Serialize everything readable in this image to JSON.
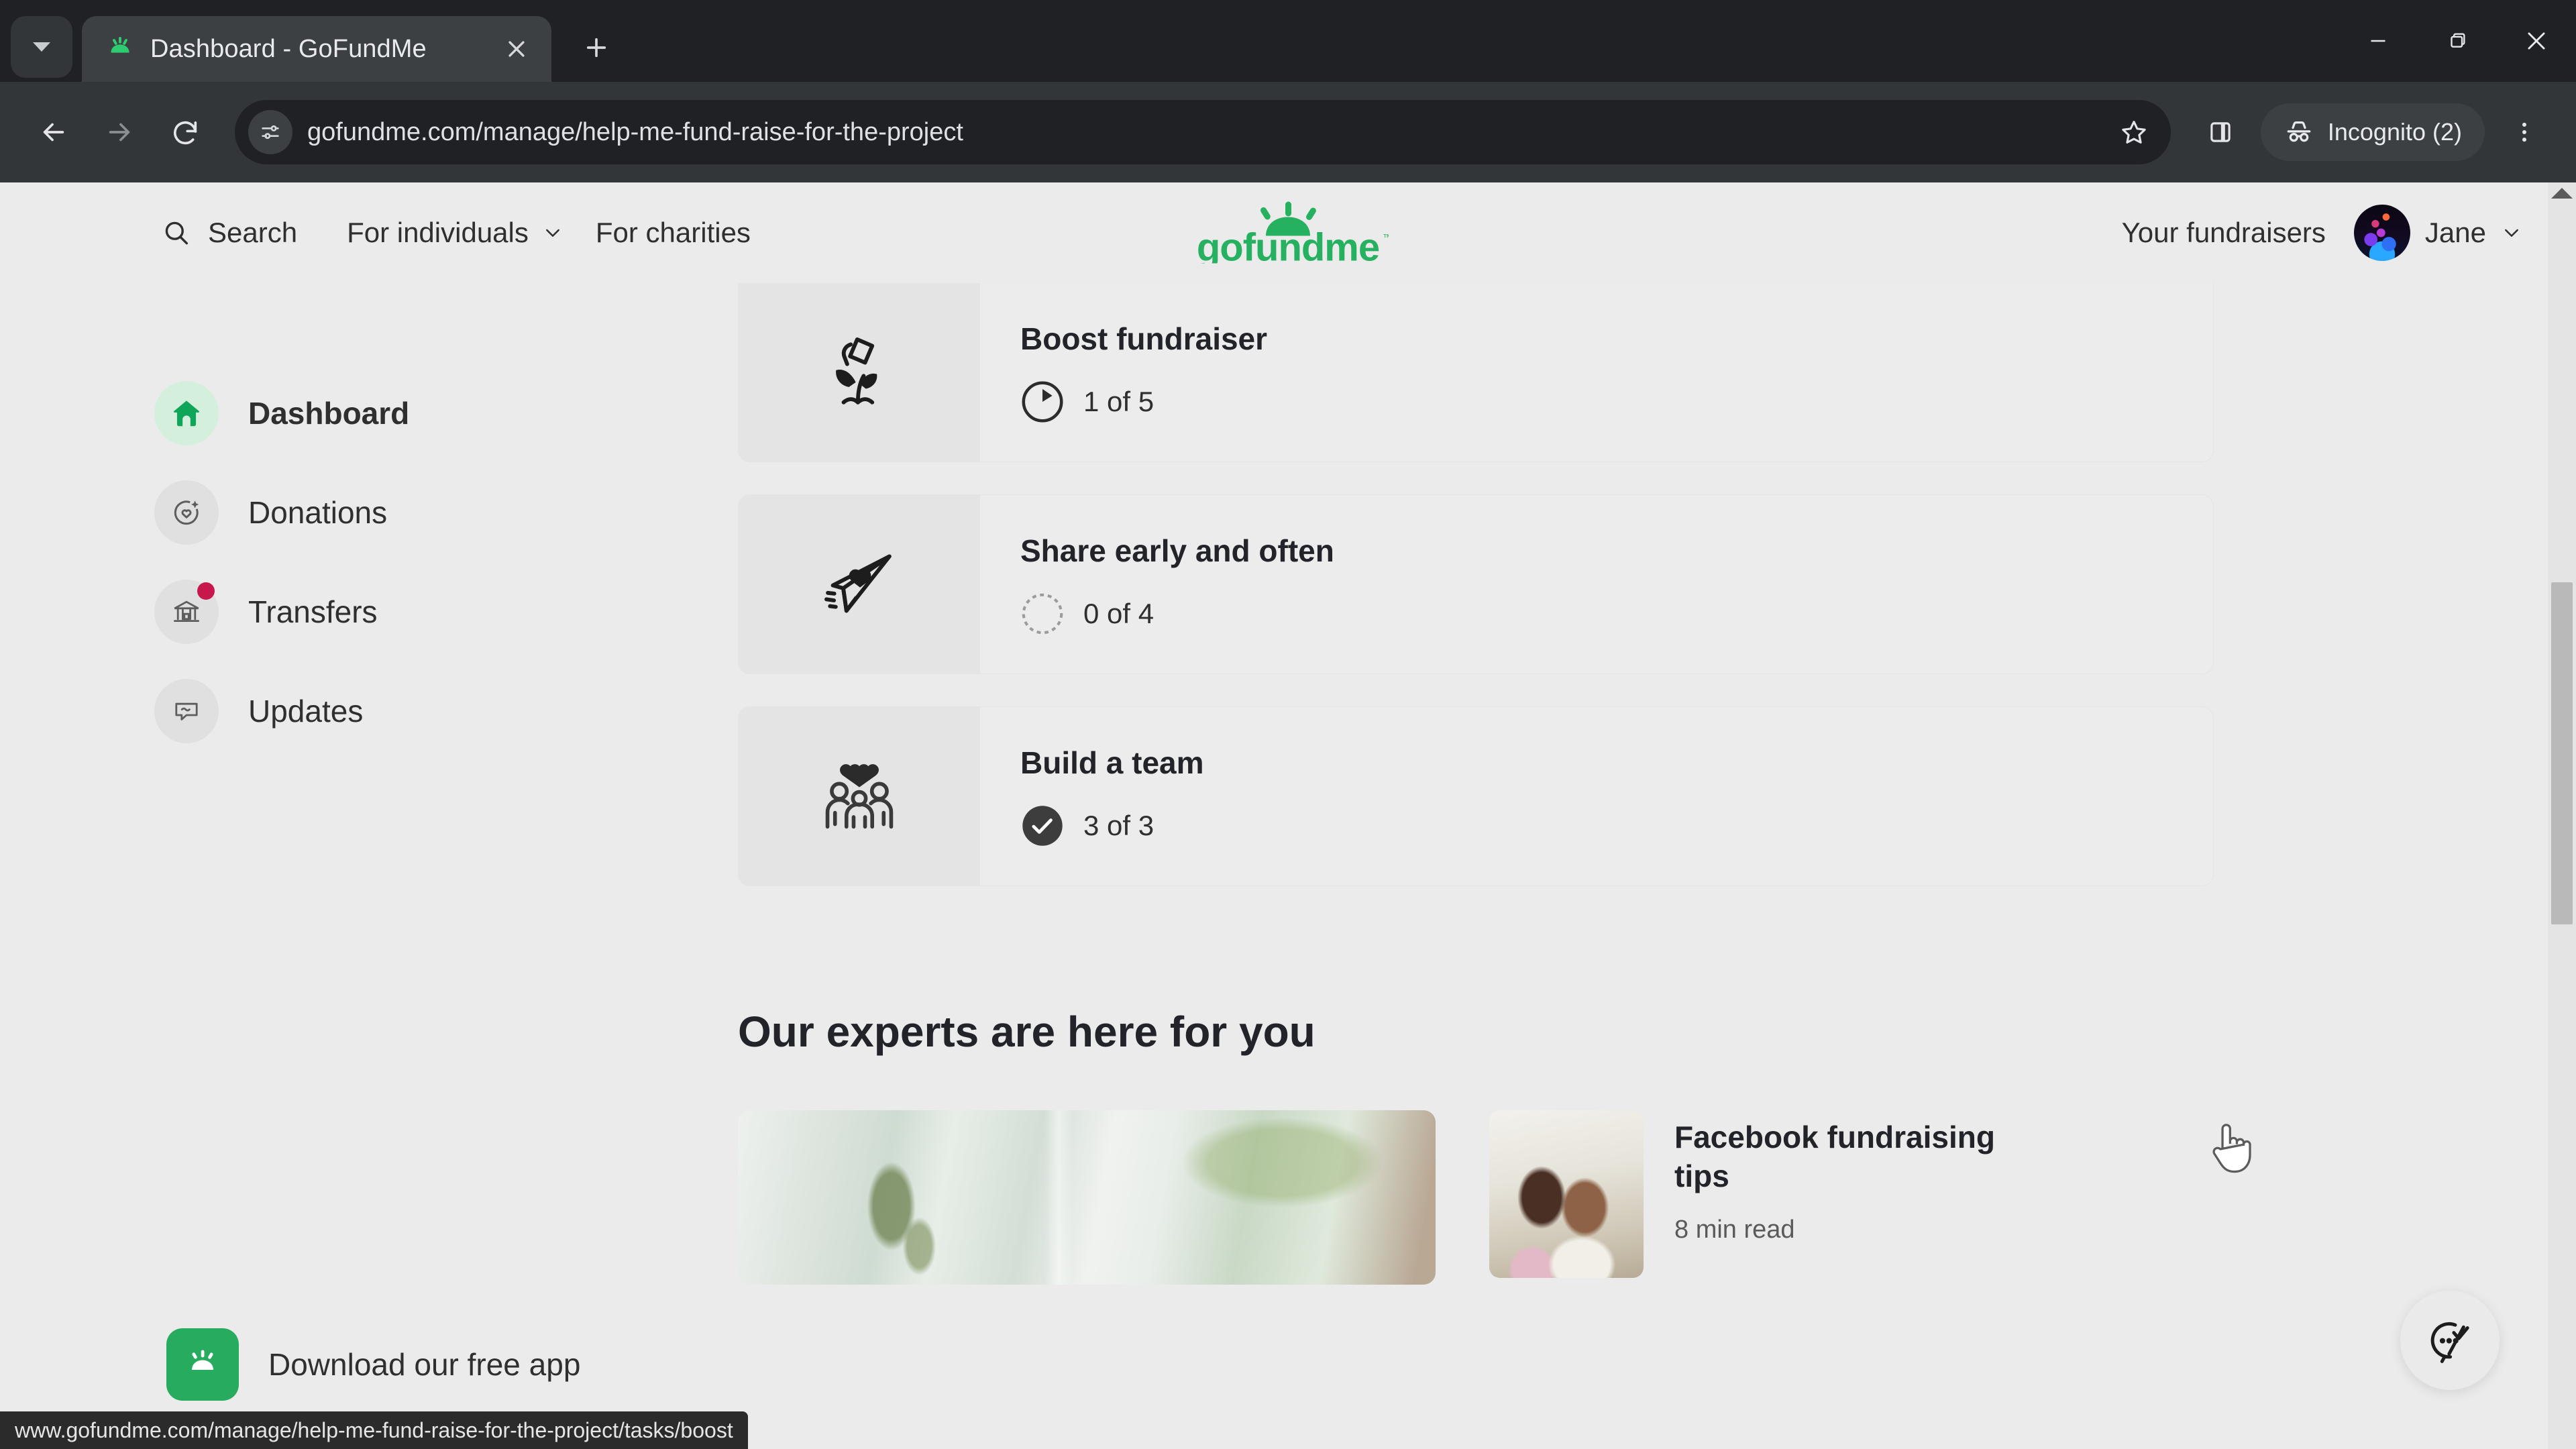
{
  "browser": {
    "tab": {
      "title": "Dashboard - GoFundMe",
      "favicon": "gofundme-logo-icon"
    },
    "new_tab_label": "+",
    "omnibox": {
      "url": "gofundme.com/manage/help-me-fund-raise-for-the-project",
      "site_info_icon": "site-settings-icon",
      "star_icon": "bookmark-star-icon"
    },
    "profile_pill": "Incognito (2)",
    "status_bar_url": "www.gofundme.com/manage/help-me-fund-raise-for-the-project/tasks/boost",
    "window": {
      "minimize": "minimize",
      "maximize": "restore",
      "close": "close"
    }
  },
  "header": {
    "search_label": "Search",
    "nav": [
      {
        "label": "For individuals",
        "has_chevron": true
      },
      {
        "label": "For charities",
        "has_chevron": false
      }
    ],
    "logo_text": "gofundme",
    "logo_color": "#26b161",
    "your_fundraisers": "Your fundraisers",
    "account_name": "Jane"
  },
  "sidebar": {
    "items": [
      {
        "label": "Dashboard",
        "icon": "home-icon",
        "active": true,
        "badge": false
      },
      {
        "label": "Donations",
        "icon": "donation-heart-target-icon",
        "active": false,
        "badge": false
      },
      {
        "label": "Transfers",
        "icon": "bank-icon",
        "active": false,
        "badge": true
      },
      {
        "label": "Updates",
        "icon": "speech-bubble-icon",
        "active": false,
        "badge": false
      }
    ],
    "download_app": {
      "label": "Download our free app",
      "icon": "gofundme-app-icon",
      "color": "#27ab5f"
    }
  },
  "tasks": [
    {
      "title": "Boost fundraiser",
      "progress_text": "1 of 5",
      "state": "in-progress",
      "icon": "watering-can-sprout-icon",
      "completed": 1,
      "total": 5
    },
    {
      "title": "Share early and often",
      "progress_text": "0 of 4",
      "state": "not-started",
      "icon": "paper-plane-heart-icon",
      "completed": 0,
      "total": 4
    },
    {
      "title": "Build a team",
      "progress_text": "3 of 3",
      "state": "complete",
      "icon": "people-heart-icon",
      "completed": 3,
      "total": 3
    }
  ],
  "experts": {
    "heading": "Our experts are here for you",
    "hero_image_alt": "window-plant-photo",
    "article": {
      "title": "Facebook fundraising tips",
      "meta": "8 min read",
      "thumb_alt": "couple-looking-at-phone-photo"
    }
  },
  "support_fab": {
    "icon": "chat-check-icon"
  },
  "cursor": {
    "type": "pointer-hand"
  }
}
